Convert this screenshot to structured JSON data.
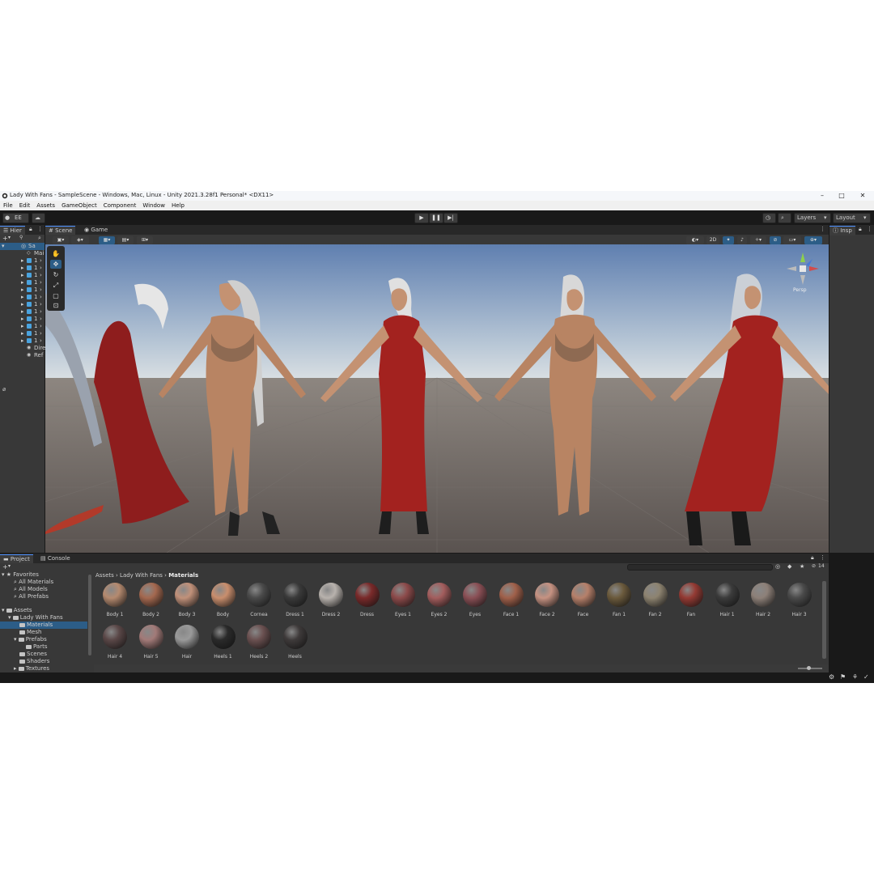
{
  "window": {
    "title": "Lady With Fans - SampleScene - Windows, Mac, Linux - Unity 2021.3.28f1 Personal* <DX11>",
    "controls": [
      "–",
      "□",
      "✕"
    ]
  },
  "menu": [
    "File",
    "Edit",
    "Assets",
    "GameObject",
    "Component",
    "Window",
    "Help"
  ],
  "toolbar": {
    "account": "EE",
    "play_icons": [
      "▶",
      "❚❚",
      "▶|"
    ],
    "layers": "Layers",
    "layout": "Layout"
  },
  "hierarchy": {
    "tab": "Hier",
    "scene_name": "Sa",
    "items": [
      "Mai",
      "1",
      "1",
      "1",
      "1",
      "1",
      "1",
      "1",
      "1",
      "1",
      "1",
      "1",
      "1",
      "Dire",
      "Ref"
    ]
  },
  "scene_tabs": {
    "scene": "Scene",
    "game": "Game"
  },
  "scene_toolbar": {
    "mode2d": "2D"
  },
  "gizmo": {
    "persp": "Persp"
  },
  "inspector": {
    "tab": "Insp"
  },
  "project": {
    "tabs": {
      "project": "Project",
      "console": "Console"
    },
    "search_placeholder": "",
    "count": "14",
    "favorites": {
      "label": "Favorites",
      "items": [
        "All Materials",
        "All Models",
        "All Prefabs"
      ]
    },
    "assets": {
      "label": "Assets",
      "root": "Lady With Fans",
      "folders": [
        "Materials",
        "Mesh",
        "Prefabs",
        "Parts",
        "Scenes",
        "Shaders",
        "Textures"
      ]
    },
    "breadcrumb": [
      "Assets",
      "Lady With Fans",
      "Materials"
    ],
    "materials": [
      {
        "name": "Body 1",
        "color": "#b58a6f"
      },
      {
        "name": "Body 2",
        "color": "#a4684f"
      },
      {
        "name": "Body 3",
        "color": "#c1917a"
      },
      {
        "name": "Body",
        "color": "#c98e6d"
      },
      {
        "name": "Cornea",
        "color": "#4a4a4a"
      },
      {
        "name": "Dress 1",
        "color": "#3a3a3a"
      },
      {
        "name": "Dress 2",
        "color": "#b8b2ad"
      },
      {
        "name": "Dress",
        "color": "#7a2a2a"
      },
      {
        "name": "Eyes 1",
        "color": "#8c4a4a"
      },
      {
        "name": "Eyes 2",
        "color": "#a35d5d"
      },
      {
        "name": "Eyes",
        "color": "#8a4f55"
      },
      {
        "name": "Face 1",
        "color": "#a0604a"
      },
      {
        "name": "Face 2",
        "color": "#c69282"
      },
      {
        "name": "Face",
        "color": "#b6806a"
      },
      {
        "name": "Fan 1",
        "color": "#6b5a3c"
      },
      {
        "name": "Fan 2",
        "color": "#8d8370"
      },
      {
        "name": "Fan",
        "color": "#943a33"
      },
      {
        "name": "Hair 1",
        "color": "#3b3b3b"
      },
      {
        "name": "Hair 2",
        "color": "#8d8078"
      },
      {
        "name": "Hair 3",
        "color": "#4a4a4a"
      },
      {
        "name": "Hair 4",
        "color": "#5a4747"
      },
      {
        "name": "Hair 5",
        "color": "#a27a78"
      },
      {
        "name": "Hair",
        "color": "#9a9a9a"
      },
      {
        "name": "Heels 1",
        "color": "#2a2a2a"
      },
      {
        "name": "Heels 2",
        "color": "#6a5050"
      },
      {
        "name": "Heels",
        "color": "#3e3a3a"
      }
    ]
  }
}
